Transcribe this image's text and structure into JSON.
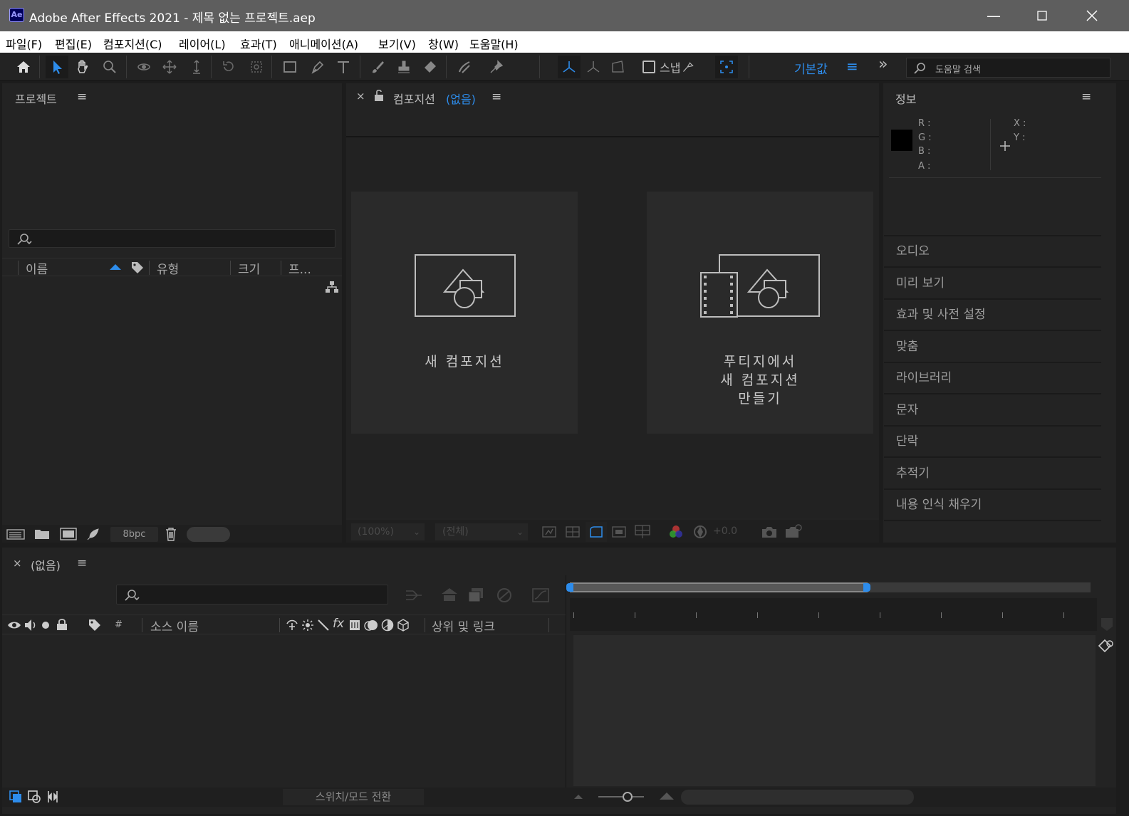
{
  "window": {
    "title": "Adobe After Effects 2021 - 제목 없는 프로젝트.aep",
    "app_logo": "Ae",
    "minimize": "—",
    "maximize": "☐",
    "close": "✕"
  },
  "menu": [
    "파일(F)",
    "편집(E)",
    "컴포지션(C)",
    "레이어(L)",
    "효과(T)",
    "애니메이션(A)",
    "보기(V)",
    "창(W)",
    "도움말(H)"
  ],
  "toolbar": {
    "snap_label": "스냅",
    "workspace_label": "기본값",
    "more": "»",
    "help_search_placeholder": "도움말 검색",
    "tools": [
      "home-icon",
      "selection-tool-icon",
      "hand-tool-icon",
      "zoom-tool-icon",
      "orbit-camera-icon",
      "pan-camera-icon",
      "dolly-camera-icon",
      "rotation-tool-icon",
      "pan-behind-icon",
      "rectangle-tool-icon",
      "pen-tool-icon",
      "type-tool-icon",
      "brush-tool-icon",
      "clone-stamp-icon",
      "eraser-tool-icon",
      "roto-brush-icon",
      "puppet-pin-icon"
    ]
  },
  "project_panel": {
    "title": "프로젝트",
    "columns": {
      "name": "이름",
      "type": "유형",
      "size": "크기",
      "frame": "프..."
    },
    "bpc": "8bpc"
  },
  "composition_panel": {
    "close": "×",
    "title": "컴포지션",
    "subtitle": "(없음)",
    "card_new": "새 컴포지션",
    "card_footage": [
      "푸티지에서",
      "새 컴포지션",
      "만들기"
    ],
    "zoom": "(100%)",
    "resolution": "(전체)",
    "exposure": "+0.0"
  },
  "info_panel": {
    "title": "정보",
    "r": "R :",
    "g": "G :",
    "b": "B :",
    "a": "A :",
    "x": "X :",
    "y": "Y :"
  },
  "side_panels": [
    "오디오",
    "미리 보기",
    "효과 및 사전 설정",
    "맞춤",
    "라이브러리",
    "문자",
    "단락",
    "추적기",
    "내용 인식 채우기"
  ],
  "timeline": {
    "close": "×",
    "title": "(없음)",
    "columns": {
      "num": "#",
      "source_name": "소스 이름",
      "parent": "상위 및 링크"
    },
    "toggle_label": "스위치/모드 전환"
  },
  "colors": {
    "accent": "#2d8ceb",
    "bg": "#1c1c1c",
    "panel": "#232323"
  }
}
